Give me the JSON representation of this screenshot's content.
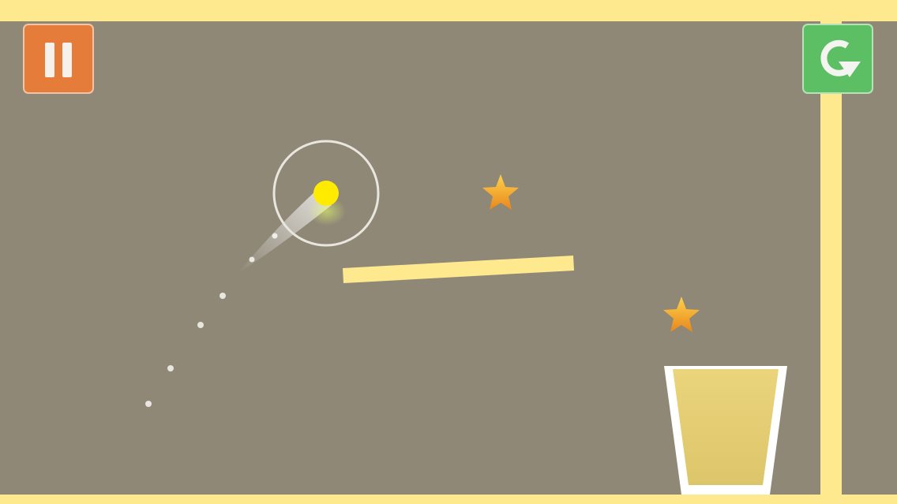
{
  "game": {
    "controls": {
      "pause_icon": "pause-icon",
      "restart_icon": "restart-icon",
      "pause_color": "#e57c3a",
      "restart_color": "#5cbf63"
    },
    "colors": {
      "background": "#8f8877",
      "walls": "#ffe98f",
      "ball": "#ffeb00",
      "star": "#f5a623",
      "cup_fill": "#e6d27a",
      "cup_rim": "#ffffff"
    },
    "stars_visible": 2
  }
}
